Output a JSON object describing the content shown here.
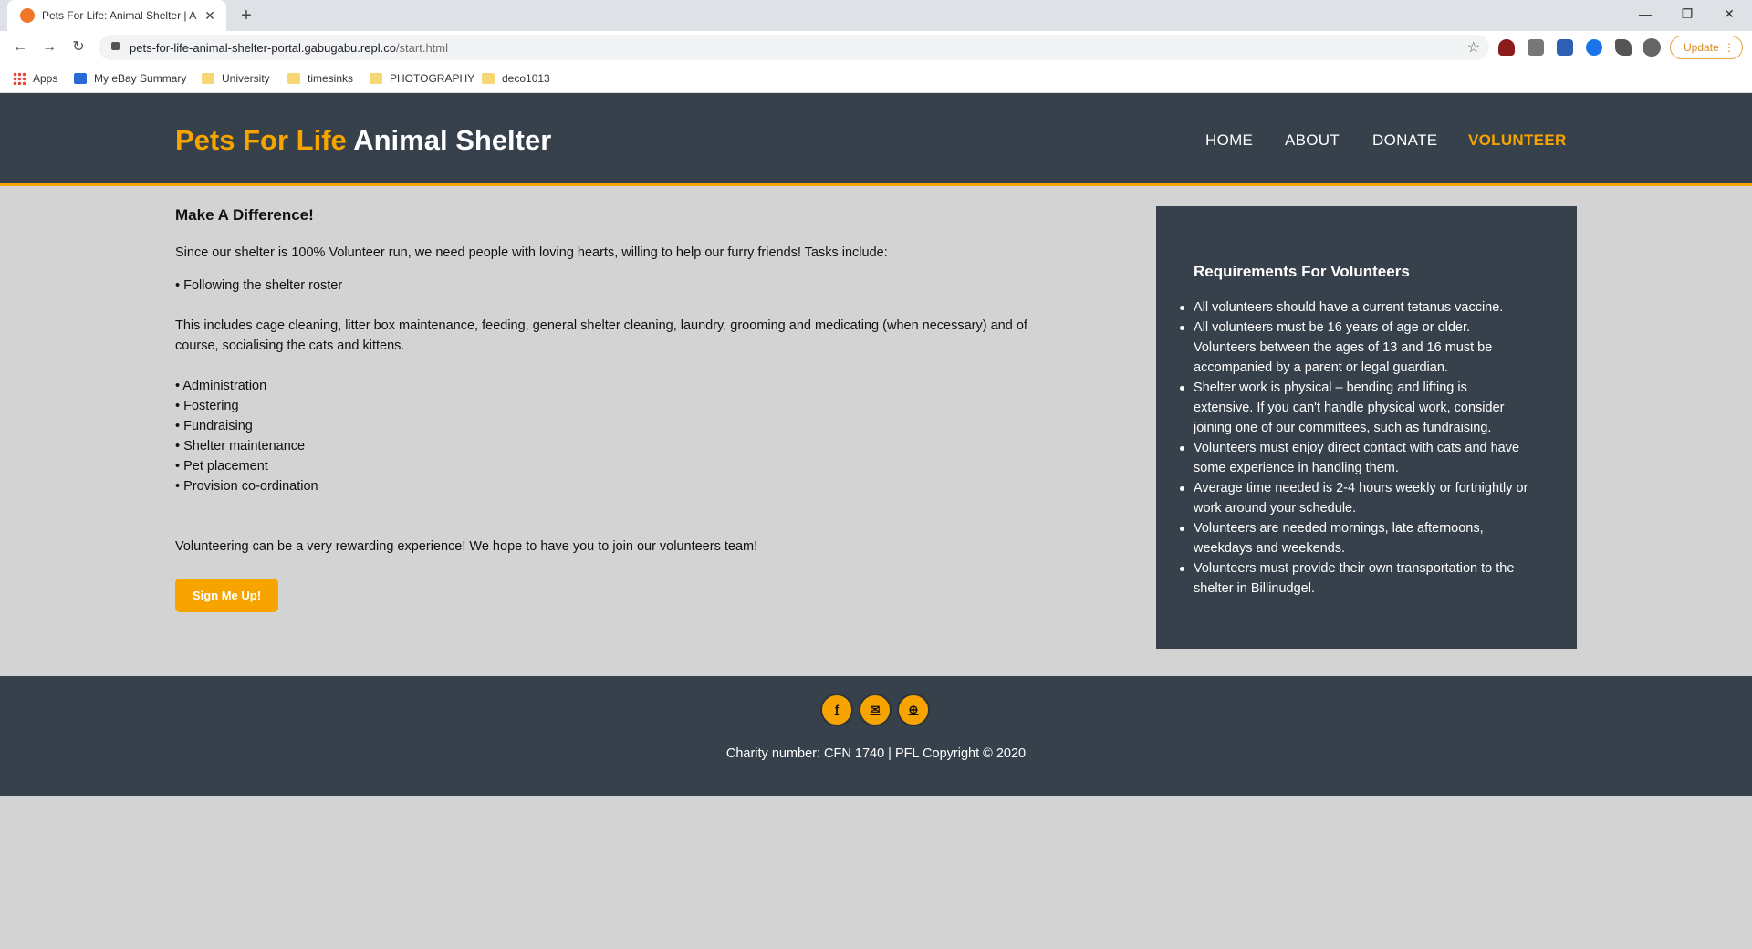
{
  "browser": {
    "tab_title": "Pets For Life: Animal Shelter | Ab",
    "tab_close": "✕",
    "new_tab": "+",
    "url_host": "pets-for-life-animal-shelter-portal.gabugabu.repl.co",
    "url_path": "/start.html",
    "update_label": "Update",
    "back": "←",
    "forward": "→",
    "reload": "↻",
    "star": "☆",
    "minimize": "—",
    "restore": "❐",
    "close": "✕",
    "menu_dots": "⋮",
    "bookmarks": [
      {
        "label": "Apps",
        "icon": "apps-grid-icon"
      },
      {
        "label": "My eBay Summary",
        "icon": "ebay-bag-icon"
      },
      {
        "label": "University",
        "icon": "folder-icon"
      },
      {
        "label": "timesinks",
        "icon": "folder-icon"
      },
      {
        "label": "PHOTOGRAPHY",
        "icon": "folder-icon"
      },
      {
        "label": "deco1013",
        "icon": "folder-icon"
      }
    ]
  },
  "header": {
    "brand_accent": "Pets For Life",
    "brand_rest": "Animal Shelter",
    "nav": [
      {
        "label": "HOME"
      },
      {
        "label": "ABOUT"
      },
      {
        "label": "DONATE"
      },
      {
        "label": "VOLUNTEER",
        "active": true
      }
    ]
  },
  "main": {
    "heading": "Make A Difference!",
    "intro": "Since our shelter is 100% Volunteer run, we need people with loving hearts, willing to help our furry friends! Tasks include:",
    "task_roster": "• Following the shelter roster",
    "roster_detail_1": "This includes cage cleaning, litter box maintenance, feeding, general shelter cleaning, laundry, grooming and medicating (when necessary) and of",
    "roster_detail_2": "course, socialising the cats and kittens.",
    "tasks": [
      "• Administration",
      "• Fostering",
      "• Fundraising",
      "• Shelter maintenance",
      "• Pet placement",
      "• Provision co-ordination"
    ],
    "closing": "Volunteering can be a very rewarding experience! We hope to have you to join our volunteers team!",
    "signup_label": "Sign Me Up!"
  },
  "requirements": {
    "title": "Requirements For Volunteers",
    "items": [
      [
        "All volunteers should have a current tetanus vaccine."
      ],
      [
        "All volunteers must be 16 years of age or older.",
        "Volunteers between the ages of 13 and 16 must be",
        "accompanied by a parent or legal guardian."
      ],
      [
        "Shelter work is physical – bending and lifting is",
        "extensive. If you can't handle physical work, consider",
        "joining one of our committees, such as fundraising."
      ],
      [
        "Volunteers must enjoy direct contact with cats and have",
        "some experience in handling them."
      ],
      [
        "Average time needed is 2-4 hours weekly or fortnightly or",
        "work around your schedule."
      ],
      [
        "Volunteers are needed mornings, late afternoons,",
        "weekdays and weekends."
      ],
      [
        "Volunteers must provide their own transportation to the",
        "shelter in Billinudgel."
      ]
    ]
  },
  "footer": {
    "social": [
      {
        "glyph": "f",
        "icon": "facebook-icon"
      },
      {
        "glyph": "✉",
        "icon": "email-icon"
      },
      {
        "glyph": "⊕",
        "icon": "globe-icon"
      }
    ],
    "copyright": "Charity number: CFN 1740 | PFL Copyright © 2020"
  },
  "colors": {
    "accent": "#f7a400",
    "dark": "#36414b",
    "page_bg": "#d3d3d3"
  }
}
